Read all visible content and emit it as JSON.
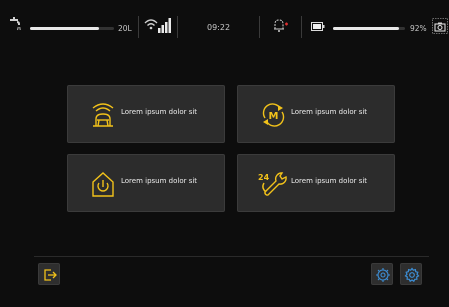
{
  "status": {
    "water_level_label": "20L",
    "water_level": 0.82,
    "time": "09:22",
    "battery_percent_label": "92%",
    "battery_level": 0.92,
    "icons": [
      "faucet-icon",
      "wifi-signal-icon",
      "bell-alert-icon",
      "battery-icon",
      "camera-icon"
    ]
  },
  "tiles": [
    {
      "label": "Lorem ipsum dolor sit",
      "icon": "wireless-station-icon"
    },
    {
      "label": "Lorem ipsum dolor sit",
      "icon": "manual-cycle-icon"
    },
    {
      "label": "Lorem ipsum dolor sit",
      "icon": "home-power-icon"
    },
    {
      "label": "Lorem ipsum dolor sit",
      "icon": "24h-service-wrench-icon"
    }
  ],
  "bottom": {
    "left_buttons": [
      "exit-icon"
    ],
    "right_buttons": [
      "gear-chip-icon",
      "gear-icon"
    ]
  },
  "colors": {
    "accent": "#f2c21a",
    "background": "#0d0d0d",
    "tile": "#2c2c2c",
    "alert": "#e03030"
  }
}
